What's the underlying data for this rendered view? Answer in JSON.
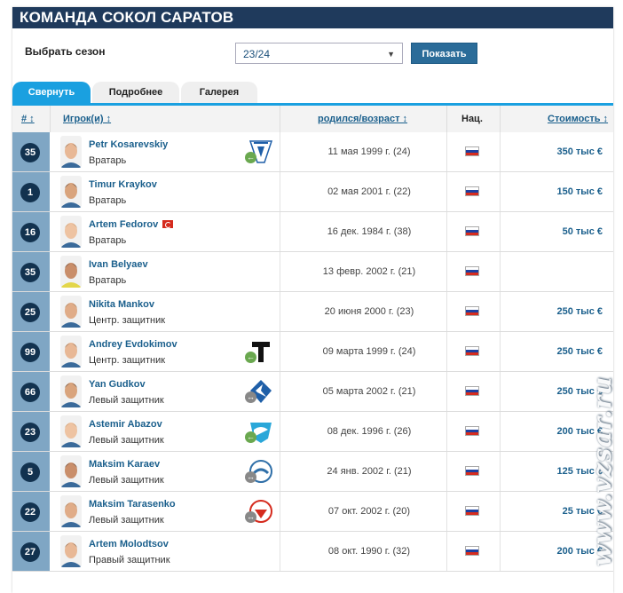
{
  "header": {
    "title": "КОМАНДА СОКОЛ САРАТОВ"
  },
  "season": {
    "label": "Выбрать сезон",
    "selected": "23/24",
    "button": "Показать"
  },
  "tabs": [
    {
      "label": "Свернуть",
      "active": true
    },
    {
      "label": "Подробнее",
      "active": false
    },
    {
      "label": "Галерея",
      "active": false
    }
  ],
  "columns": {
    "num": "# ↕",
    "player": "Игрок(и) ↕",
    "born": "родился/возраст ↕",
    "nat": "Нац.",
    "value": "Стоимость ↕"
  },
  "players": [
    {
      "num": "35",
      "name": "Petr Kosarevskiy",
      "position": "Вратарь",
      "born": "11 мая 1999 г. (24)",
      "value": "350 тыс €",
      "club": "velez-logo",
      "transfer": "in"
    },
    {
      "num": "1",
      "name": "Timur Kraykov",
      "position": "Вратарь",
      "born": "02 мая 2001 г. (22)",
      "value": "150 тыс €"
    },
    {
      "num": "16",
      "name": "Artem Fedorov",
      "position": "Вратарь",
      "born": "16 дек. 1984 г. (38)",
      "value": "50 тыс €",
      "second_nat": "turkey-flag"
    },
    {
      "num": "35",
      "name": "Ivan Belyaev",
      "position": "Вратарь",
      "born": "13 февр. 2002 г. (21)",
      "value": ""
    },
    {
      "num": "25",
      "name": "Nikita Mankov",
      "position": "Центр. защитник",
      "born": "20 июня 2000 г. (23)",
      "value": "250 тыс €"
    },
    {
      "num": "99",
      "name": "Andrey Evdokimov",
      "position": "Центр. защитник",
      "born": "09 марта 1999 г. (24)",
      "value": "250 тыс €",
      "club": "torpedo-logo",
      "transfer": "in"
    },
    {
      "num": "66",
      "name": "Yan Gudkov",
      "position": "Левый защитник",
      "born": "05 марта 2002 г. (21)",
      "value": "250 тыс €",
      "club": "krylia-logo",
      "transfer": "loan"
    },
    {
      "num": "23",
      "name": "Astemir Abazov",
      "position": "Левый защитник",
      "born": "08 дек. 1996 г. (26)",
      "value": "200 тыс €",
      "club": "volna-logo",
      "transfer": "in"
    },
    {
      "num": "5",
      "name": "Maksim Karaev",
      "position": "Левый защитник",
      "born": "24 янв. 2002 г. (21)",
      "value": "125 тыс €",
      "club": "baltika-logo",
      "transfer": "loan"
    },
    {
      "num": "22",
      "name": "Maksim Tarasenko",
      "position": "Левый защитник",
      "born": "07 окт. 2002 г. (20)",
      "value": "25 тыс €",
      "club": "spartak-logo",
      "transfer": "loan"
    },
    {
      "num": "27",
      "name": "Artem Molodtsov",
      "position": "Правый защитник",
      "born": "08 окт. 1990 г. (32)",
      "value": "200 тыс €"
    }
  ],
  "watermark": "www.vzsar.ru",
  "colors": {
    "header_bg": "#1f3a5c",
    "tab_active": "#1aa0e0",
    "num_cell": "#7fa6c4",
    "badge": "#12324f",
    "link": "#1a5f8c"
  }
}
